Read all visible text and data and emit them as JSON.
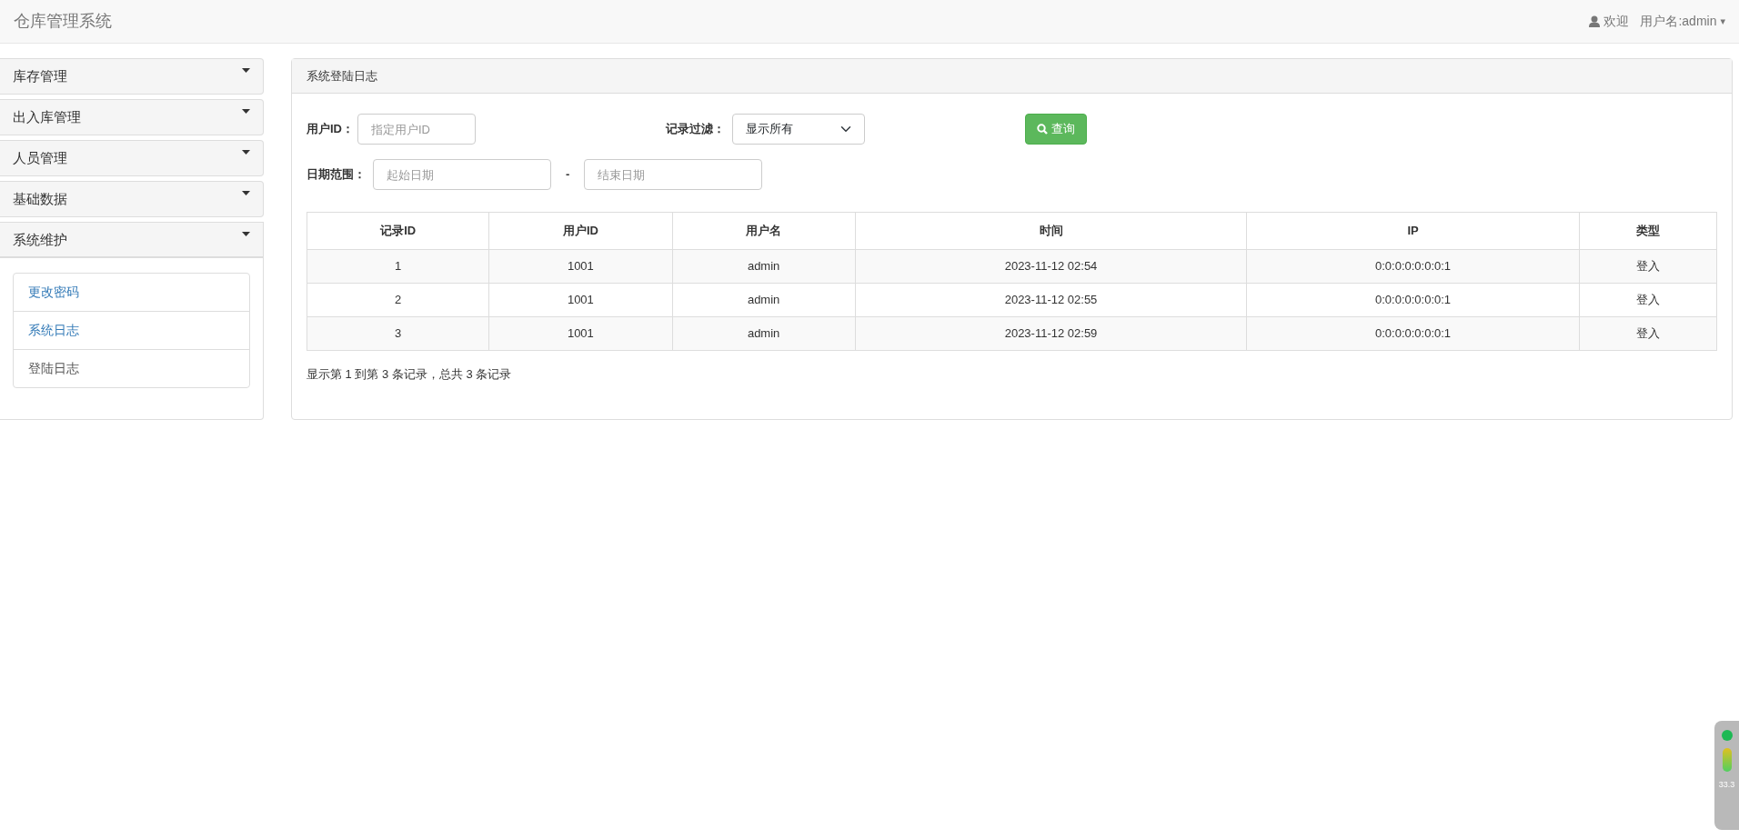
{
  "navbar": {
    "brand": "仓库管理系统",
    "user": {
      "greeting": "欢迎",
      "label": "用户名:admin",
      "caret": "▾"
    }
  },
  "sidebar": {
    "groups": [
      {
        "label": "库存管理",
        "expanded": false
      },
      {
        "label": "出入库管理",
        "expanded": false
      },
      {
        "label": "人员管理",
        "expanded": false
      },
      {
        "label": "基础数据",
        "expanded": false
      },
      {
        "label": "系统维护",
        "expanded": true,
        "items": [
          {
            "label": "更改密码",
            "kind": "link"
          },
          {
            "label": "系统日志",
            "kind": "link"
          },
          {
            "label": "登陆日志",
            "kind": "plain"
          }
        ]
      }
    ]
  },
  "panel": {
    "title": "系统登陆日志",
    "filters": {
      "user_id": {
        "label": "用户ID：",
        "placeholder": "指定用户ID"
      },
      "record_filter": {
        "label": "记录过滤：",
        "value": "显示所有"
      },
      "query_button": "查询",
      "date_range": {
        "label": "日期范围：",
        "start_placeholder": "起始日期",
        "separator": "-",
        "end_placeholder": "结束日期"
      }
    },
    "table": {
      "columns": [
        "记录ID",
        "用户ID",
        "用户名",
        "时间",
        "IP",
        "类型"
      ],
      "rows": [
        [
          "1",
          "1001",
          "admin",
          "2023-11-12 02:54",
          "0:0:0:0:0:0:0:1",
          "登入"
        ],
        [
          "2",
          "1001",
          "admin",
          "2023-11-12 02:55",
          "0:0:0:0:0:0:0:1",
          "登入"
        ],
        [
          "3",
          "1001",
          "admin",
          "2023-11-12 02:59",
          "0:0:0:0:0:0:0:1",
          "登入"
        ]
      ]
    },
    "summary": "显示第 1 到第 3 条记录，总共 3 条记录"
  },
  "speed_widget": {
    "reading": "33.3"
  }
}
